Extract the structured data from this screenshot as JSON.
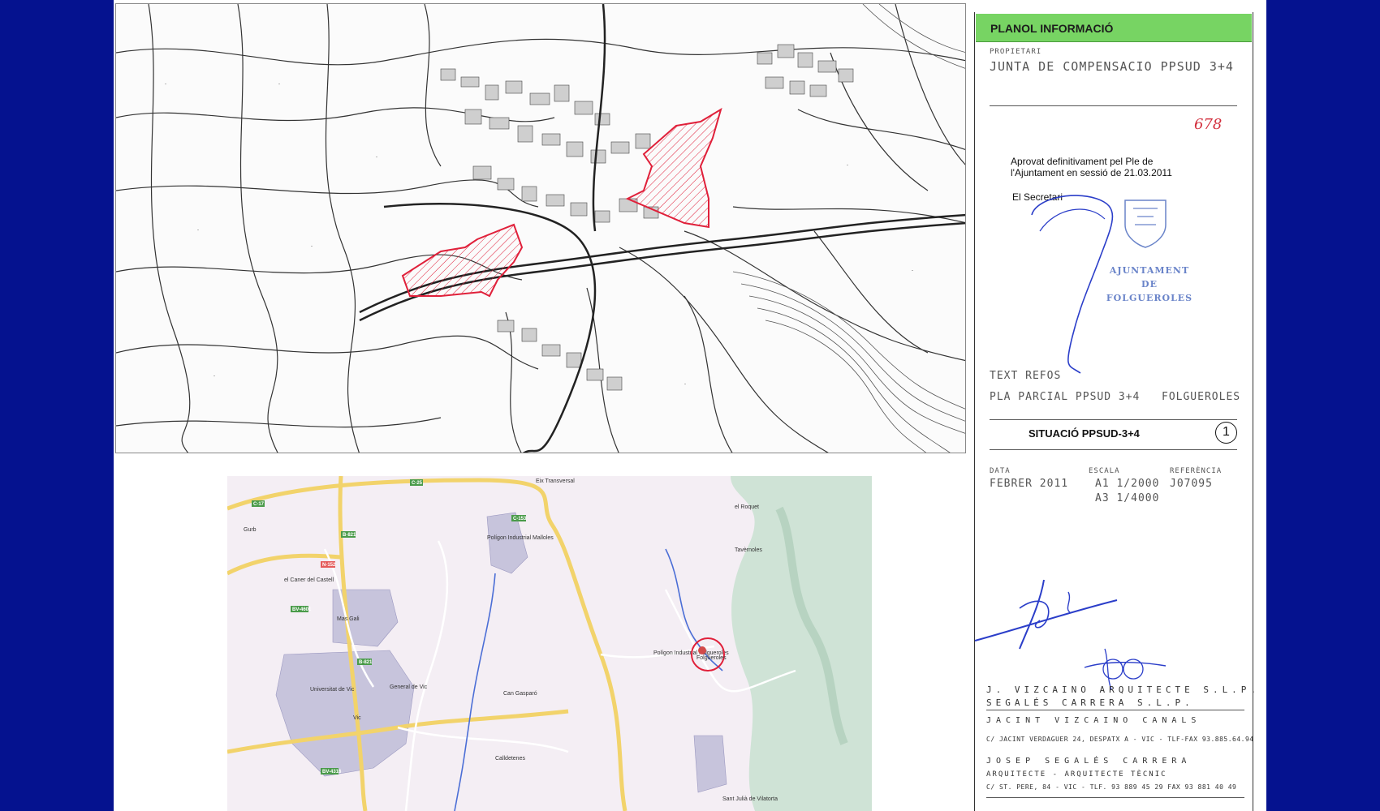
{
  "title_block": {
    "header": "PLANOL INFORMACIÓ",
    "owner_label": "PROPIETARI",
    "owner_value": "JUNTA DE COMPENSACIO PPSUD 3+4",
    "handwritten_number": "678",
    "approval_line1": "Aprovat definitivament pel Ple de",
    "approval_line2": "l'Ajuntament en sessió de 21.03.2011",
    "secretary": "El Secretari",
    "stamp": {
      "line1": "AJUNTAMENT",
      "line2": "DE",
      "line3": "FOLGUEROLES"
    },
    "text_refos": "TEXT REFOS",
    "plan_name": "PLA PARCIAL PPSUD 3+4",
    "plan_town": "FOLGUEROLES",
    "sheet_title": "SITUACIÓ PPSUD-3+4",
    "sheet_number": "1",
    "date_label": "DATA",
    "date_value": "FEBRER 2011",
    "scale_label": "ESCALA",
    "scale_a1": "A1 1/2000",
    "scale_a3": "A3 1/4000",
    "ref_label": "REFERÈNCIA",
    "ref_value": "J07095",
    "firm1": "J. VIZCAINO ARQUITECTE S.L.P.",
    "firm2": "SEGALÉS CARRERA S.L.P.",
    "person1": "JACINT VIZCAINO CANALS",
    "address1": "C/ JACINT VERDAGUER 24, DESPATX A - VIC - TLF-FAX 93.885.64.94",
    "person2": "JOSEP SEGALÉS CARRERA",
    "roles2": "ARQUITECTE - ARQUITECTE TÈCNIC",
    "address2": "C/ ST. PERE, 84 - VIC - TLF. 93 889 45 29 FAX 93 881 40 49"
  },
  "road_map": {
    "labels": {
      "gurb": "Gurb",
      "caner": "el Caner del Castell",
      "masgali": "Mas Gali",
      "poligon": "Polígon Industrial Malloles",
      "general": "General de Vic",
      "universitat": "Universitat de Vic",
      "vic": "Vic",
      "calldetenes": "Calldetenes",
      "folgueroles": "Folgueroles",
      "poligon_folg": "Polígon Industrial Folgueroles",
      "roquet": "el Roquet",
      "tavernoles": "Tavèrnoles",
      "santjulia": "Sant Julià de Vilatorta",
      "eix": "Eix Transversal",
      "con_gasparo": "Can Gasparó"
    },
    "road_codes": [
      "C-25",
      "C-17",
      "B-821",
      "C-153",
      "N-152",
      "BV-4601",
      "BV-4316",
      "B-821"
    ]
  },
  "colors": {
    "background": "#05128f",
    "header_green": "#77d463",
    "highlight_red": "#e0203a",
    "ink_blue": "#2b3ec9",
    "stamp_blue": "#6a84c9"
  }
}
